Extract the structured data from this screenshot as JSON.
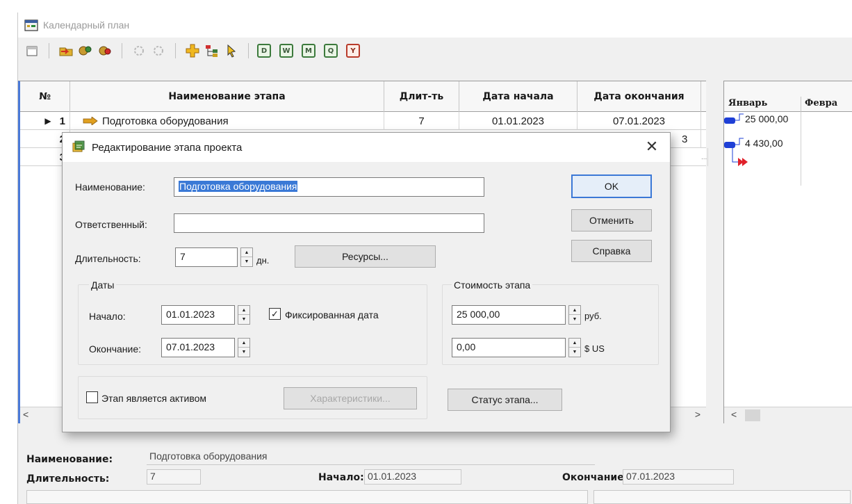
{
  "window": {
    "title": "Календарный план"
  },
  "toolbar": {
    "buttons": [
      "calendar-icon",
      "arrow-folder-icon",
      "gears-icon",
      "gears-red-icon",
      "gear-outline-icon",
      "gear-outline-icon",
      "plus-icon",
      "tree-icon",
      "pointer-icon"
    ],
    "scale_buttons": [
      "D",
      "W",
      "M",
      "Q",
      "Y"
    ]
  },
  "grid": {
    "columns": [
      "№",
      "Наименование этапа",
      "Длит-ть",
      "Дата начала",
      "Дата окончания"
    ],
    "rows": [
      {
        "num": "1",
        "name": "Подготовка оборудования",
        "duration": "7",
        "start": "01.01.2023",
        "end": "07.01.2023"
      },
      {
        "num": "2",
        "name": "",
        "duration": "",
        "start": "",
        "end": ""
      },
      {
        "num": "3",
        "name": "",
        "duration": "",
        "start": "",
        "end": ""
      }
    ],
    "row2_end_fragment": "3",
    "ellipsis": "..."
  },
  "gantt": {
    "months": [
      "Январь",
      "Февра"
    ],
    "values": [
      "25 000,00",
      "4 430,00"
    ]
  },
  "info": {
    "name_label": "Наименование:",
    "name_value": "Подготовка оборудования",
    "duration_label": "Длительность:",
    "duration_value": "7",
    "start_label": "Начало:",
    "start_value": "01.01.2023",
    "end_label": "Окончание:",
    "end_value": "07.01.2023"
  },
  "dialog": {
    "title": "Редактирование этапа проекта",
    "name_label": "Наименование:",
    "name_value": "Подготовка оборудования",
    "responsible_label": "Ответственный:",
    "responsible_value": "",
    "duration_label": "Длительность:",
    "duration_value": "7",
    "duration_unit": "дн.",
    "resources_button": "Ресурсы...",
    "dates_group": "Даты",
    "start_label": "Начало:",
    "start_value": "01.01.2023",
    "fixed_date_label": "Фиксированная дата",
    "fixed_date_checked": true,
    "end_label": "Окончание:",
    "end_value": "07.01.2023",
    "cost_group": "Стоимость этапа",
    "cost_rub_value": "25 000,00",
    "cost_rub_unit": "руб.",
    "cost_usd_value": "0,00",
    "cost_usd_unit": "$ US",
    "asset_label": "Этап является активом",
    "asset_checked": false,
    "characteristics_button": "Характеристики...",
    "status_button": "Статус этапа...",
    "ok_button": "OK",
    "cancel_button": "Отменить",
    "help_button": "Справка"
  },
  "colors": {
    "accent": "#3b78d6",
    "selection": "#3a79d6",
    "gantt_bar": "#1e3fd6",
    "gantt_arrow": "#e0202a"
  }
}
